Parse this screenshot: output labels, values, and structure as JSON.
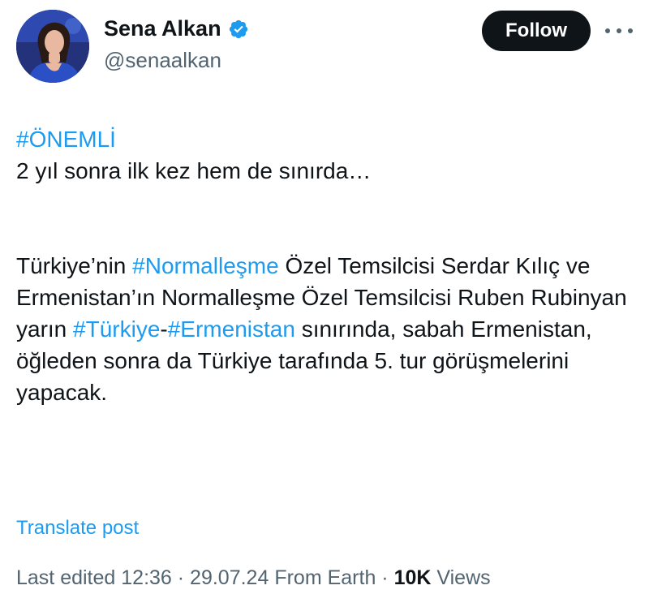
{
  "author": {
    "display_name": "Sena Alkan",
    "handle": "@senaalkan",
    "verified": true,
    "avatar_icon": "profile-photo"
  },
  "actions": {
    "follow_label": "Follow",
    "more_icon": "more-horizontal-icon"
  },
  "tweet": {
    "line1_hashtag": "#ÖNEMLİ",
    "line2": "2 yıl sonra ilk kez hem de sınırda…",
    "p2_seg1": "Türkiye’nin ",
    "p2_hash1": "#Normalleşme",
    "p2_seg2": " Özel Temsilcisi Serdar Kılıç ve Ermenistan’ın Normalleşme Özel Temsilcisi Ruben Rubinyan yarın ",
    "p2_hash2": "#Türkiye",
    "p2_seg3": "-",
    "p2_hash3": "#Ermenistan",
    "p2_seg4": " sınırında, sabah Ermenistan, öğleden sonra da Türkiye tarafında 5. tur görüşmelerini yapacak."
  },
  "translate_label": "Translate post",
  "meta": {
    "edited_prefix": "Last edited ",
    "time": "12:36",
    "separator": " · ",
    "date": "29.07.24",
    "source": "From Earth",
    "views_count": "10K",
    "views_label": " Views"
  },
  "colors": {
    "link": "#1d9bf0",
    "text": "#0f1419",
    "muted": "#536471",
    "verified": "#1d9bf0",
    "follow_bg": "#0f1419"
  }
}
